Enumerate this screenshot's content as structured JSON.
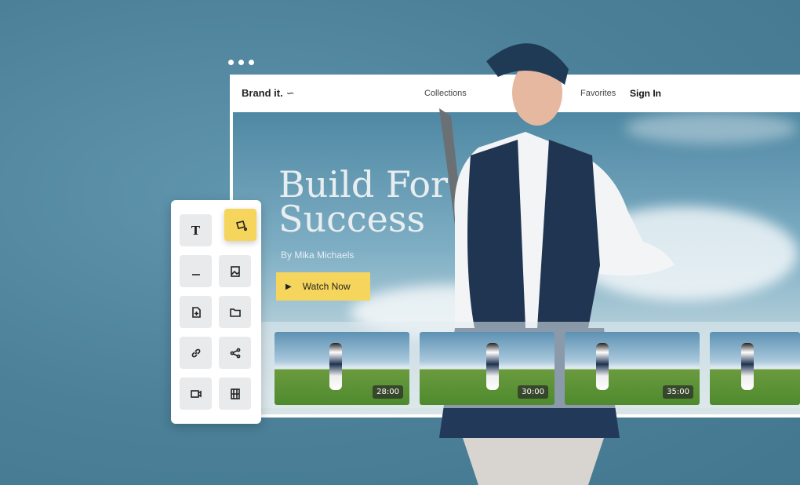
{
  "header": {
    "brand": "Brand it.",
    "brand_mark": "~",
    "nav": [
      "Collections",
      "Favorites"
    ],
    "sign_in": "Sign In"
  },
  "hero": {
    "title_line1": "Build For",
    "title_line2": "Success",
    "byline": "By Mika Michaels",
    "cta": "Watch Now"
  },
  "thumbnails": [
    {
      "duration": "28:00"
    },
    {
      "duration": "30:00"
    },
    {
      "duration": "35:00"
    },
    {
      "duration": ""
    }
  ],
  "toolbar": {
    "items": [
      "text-icon",
      "paint-bucket-icon",
      "divider-icon",
      "image-icon",
      "add-file-icon",
      "folder-icon",
      "link-icon",
      "share-icon",
      "video-icon",
      "film-icon"
    ],
    "text_glyph": "T",
    "active": "paint-bucket-icon"
  },
  "colors": {
    "accent": "#f6d55c",
    "background": "#4b8098",
    "navy": "#1d3350"
  }
}
